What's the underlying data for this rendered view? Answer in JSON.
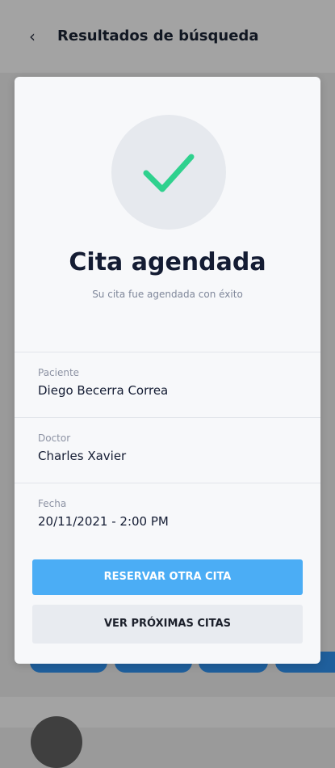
{
  "header": {
    "back_icon": "chevron-left-icon",
    "title": "Resultados de búsqueda"
  },
  "modal": {
    "status_icon": "checkmark-icon",
    "accent_color": "#2fd18e",
    "title": "Cita agendada",
    "subtitle": "Su cita fue agendada con éxito",
    "fields": [
      {
        "label": "Paciente",
        "value": "Diego Becerra Correa"
      },
      {
        "label": "Doctor",
        "value": "Charles Xavier"
      },
      {
        "label": "Fecha",
        "value": "20/11/2021 - 2:00 PM"
      }
    ],
    "primary_button": "RESERVAR OTRA CITA",
    "secondary_button": "VER PRÓXIMAS CITAS",
    "primary_color": "#4badf5"
  }
}
